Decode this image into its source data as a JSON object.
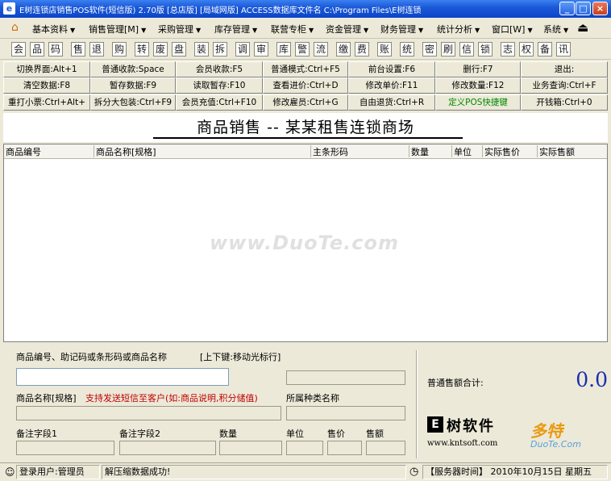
{
  "window": {
    "title": "E树连锁店销售POS软件(短信版) 2.70版 [总店版] [局域网版] ACCESS数据库文件名 C:\\Program Files\\E树连锁",
    "minimize": "_",
    "maximize": "□",
    "close": "×"
  },
  "menu": [
    {
      "label": "基本资料"
    },
    {
      "label": "销售管理[M]"
    },
    {
      "label": "采购管理"
    },
    {
      "label": "库存管理"
    },
    {
      "label": "联营专柜"
    },
    {
      "label": "资金管理"
    },
    {
      "label": "财务管理"
    },
    {
      "label": "统计分析"
    },
    {
      "label": "窗口[W]"
    },
    {
      "label": "系统"
    }
  ],
  "menu_arrow": "▼",
  "toolbar_icons": [
    {
      "glyph": "会"
    },
    {
      "glyph": "品"
    },
    {
      "glyph": "码"
    },
    {
      "glyph": "售"
    },
    {
      "glyph": "退"
    },
    {
      "glyph": "购"
    },
    {
      "glyph": "转"
    },
    {
      "glyph": "废"
    },
    {
      "glyph": "盘"
    },
    {
      "glyph": "装"
    },
    {
      "glyph": "拆"
    },
    {
      "glyph": "调"
    },
    {
      "glyph": "审"
    },
    {
      "glyph": "库"
    },
    {
      "glyph": "警"
    },
    {
      "glyph": "流"
    },
    {
      "glyph": "缴"
    },
    {
      "glyph": "费"
    },
    {
      "glyph": "账"
    },
    {
      "glyph": "统"
    },
    {
      "glyph": "密"
    },
    {
      "glyph": "刷"
    },
    {
      "glyph": "信"
    },
    {
      "glyph": "锁"
    },
    {
      "glyph": "志"
    },
    {
      "glyph": "权"
    },
    {
      "glyph": "备"
    },
    {
      "glyph": "讯"
    }
  ],
  "function_buttons": [
    [
      "切换界面:Alt+1",
      "普通收款:Space",
      "会员收款:F5",
      "普通模式:Ctrl+F5",
      "前台设置:F6",
      "删行:F7",
      "退出:"
    ],
    [
      "清空数据:F8",
      "暂存数据:F9",
      "读取暂存:F10",
      "查看进价:Ctrl+D",
      "修改单价:F11",
      "修改数量:F12",
      "业务查询:Ctrl+F"
    ],
    [
      "重打小票:Ctrl+Alt+",
      "拆分大包装:Ctrl+F9",
      "会员充值:Ctrl+F10",
      "修改雇员:Ctrl+G",
      "自由退货:Ctrl+R",
      "定义POS快捷键",
      "开钱箱:Ctrl+0"
    ]
  ],
  "shop_title": "商品销售 -- 某某租售连锁商场",
  "grid_columns": [
    "商品编号",
    "商品名称[规格]",
    "主条形码",
    "数量",
    "单位",
    "实际售价",
    "实际售额"
  ],
  "watermark": "www.DuoTe.com",
  "form": {
    "search_label": "商品编号、助记码或条形码或商品名称",
    "search_hint": "[上下键:移动光标行]",
    "search_value": "",
    "ellipsis": "···",
    "name_label": "商品名称[规格]",
    "name_note": "支持发送短信至客户(如:商品说明,积分储值)",
    "category_label": "所属种类名称",
    "remark1_label": "备注字段1",
    "remark2_label": "备注字段2",
    "qty_label": "数量",
    "unit_label": "单位",
    "price_label": "售价",
    "amount_label": "售额"
  },
  "summary": {
    "total_label": "普通售额合计:",
    "total_value": "0.0"
  },
  "logo": {
    "mark": "E",
    "name": "树软件",
    "url": "www.kntsoft.com",
    "duote": "多特",
    "duote_sub": "DuoTe.Com"
  },
  "status": {
    "user": "登录用户:管理员",
    "message": "解压缩数据成功!",
    "server_time": "【服务器时间】 2010年10月15日 星期五"
  }
}
